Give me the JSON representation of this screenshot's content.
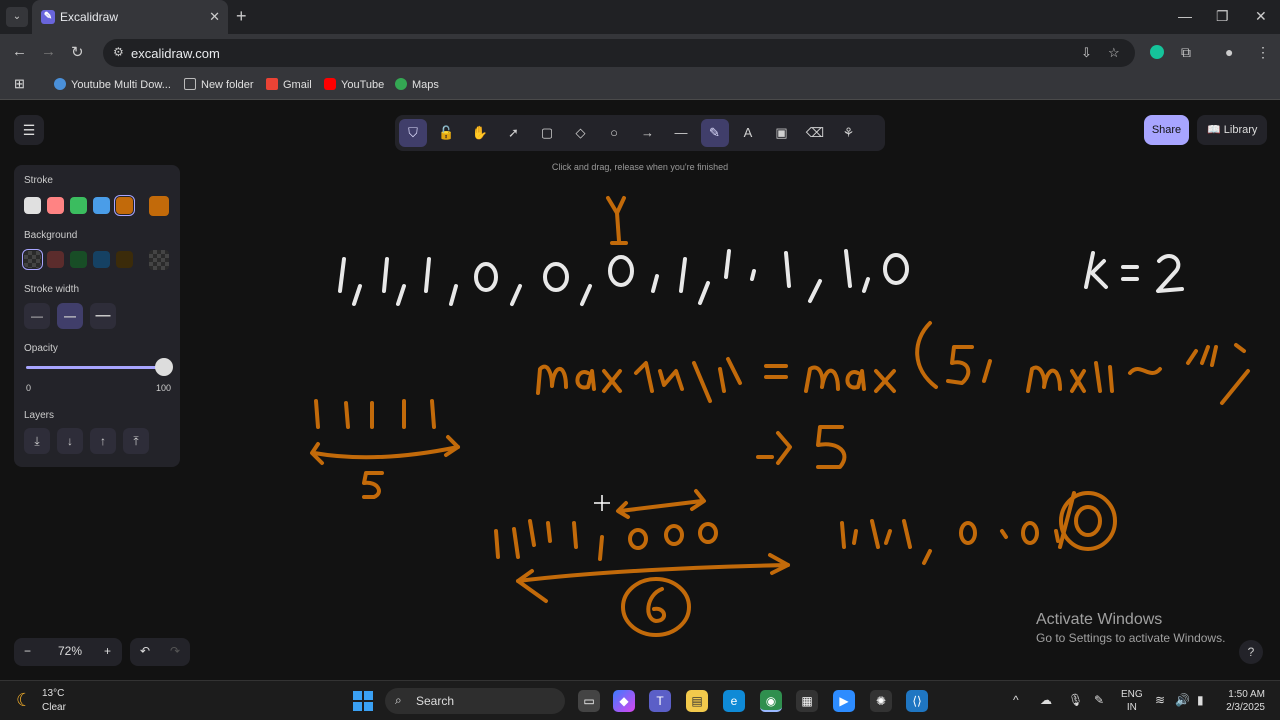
{
  "browser": {
    "tab_title": "Excalidraw",
    "url": "excalidraw.com",
    "bookmarks": [
      {
        "label": "Youtube Multi Dow...",
        "icon": "globe-icon",
        "color": "#4a90d9"
      },
      {
        "label": "New folder",
        "icon": "folder-icon",
        "color": "#bbbbbb"
      },
      {
        "label": "Gmail",
        "icon": "gmail-icon",
        "color": "#ea4335"
      },
      {
        "label": "YouTube",
        "icon": "youtube-icon",
        "color": "#ff0000"
      },
      {
        "label": "Maps",
        "icon": "maps-icon",
        "color": "#34a853"
      }
    ]
  },
  "app": {
    "tool_hint": "Click and drag, release when you're finished",
    "share_label": "Share",
    "library_label": "Library",
    "tools": [
      {
        "name": "tool-keep-active",
        "glyph": "⛉",
        "active": true
      },
      {
        "name": "tool-lock",
        "glyph": "🔓",
        "active": false
      },
      {
        "name": "tool-hand",
        "glyph": "✋",
        "active": false
      },
      {
        "name": "tool-selection",
        "glyph": "➚",
        "active": false
      },
      {
        "name": "tool-rectangle",
        "glyph": "▢",
        "active": false
      },
      {
        "name": "tool-diamond",
        "glyph": "◇",
        "active": false
      },
      {
        "name": "tool-ellipse",
        "glyph": "○",
        "active": false
      },
      {
        "name": "tool-arrow",
        "glyph": "→",
        "active": false
      },
      {
        "name": "tool-line",
        "glyph": "—",
        "active": false
      },
      {
        "name": "tool-draw",
        "glyph": "✎",
        "active": true
      },
      {
        "name": "tool-text",
        "glyph": "A",
        "active": false
      },
      {
        "name": "tool-image",
        "glyph": "▣",
        "active": false
      },
      {
        "name": "tool-eraser",
        "glyph": "⌫",
        "active": false
      },
      {
        "name": "tool-more",
        "glyph": "⚘",
        "active": false
      }
    ],
    "properties": {
      "stroke_label": "Stroke",
      "background_label": "Background",
      "stroke_width_label": "Stroke width",
      "opacity_label": "Opacity",
      "opacity_min": "0",
      "opacity_max": "100",
      "opacity_value": 100,
      "layers_label": "Layers",
      "stroke_colors": [
        "#e0e0e0",
        "#ff8383",
        "#3bbd5f",
        "#4a9de8",
        "#c26a0a"
      ],
      "current_stroke": "#c26a0a",
      "background_colors": [
        "transparent",
        "#5b2c2c",
        "#184d26",
        "#154163",
        "#3b2b0a"
      ]
    },
    "zoom_level": "72%",
    "activate_title": "Activate Windows",
    "activate_sub": "Go to Settings to activate Windows."
  },
  "canvas_text": {
    "array": "1,1,1,0,0,0,1,1,1,1,0",
    "marker": "Y",
    "k_label": "k = 2",
    "formula": "maxlength = max(5, maxlen)",
    "result": "→ 5",
    "window1": "11111",
    "window1_len": "5",
    "window2": "1,1,1,1,000",
    "window2_len": "6",
    "window3": "1,1,1,1,0,0,(0)"
  },
  "taskbar": {
    "temp": "13°C",
    "condition": "Clear",
    "search_label": "Search",
    "lang_top": "ENG",
    "lang_bottom": "IN",
    "time": "1:50 AM",
    "date": "2/3/2025"
  }
}
